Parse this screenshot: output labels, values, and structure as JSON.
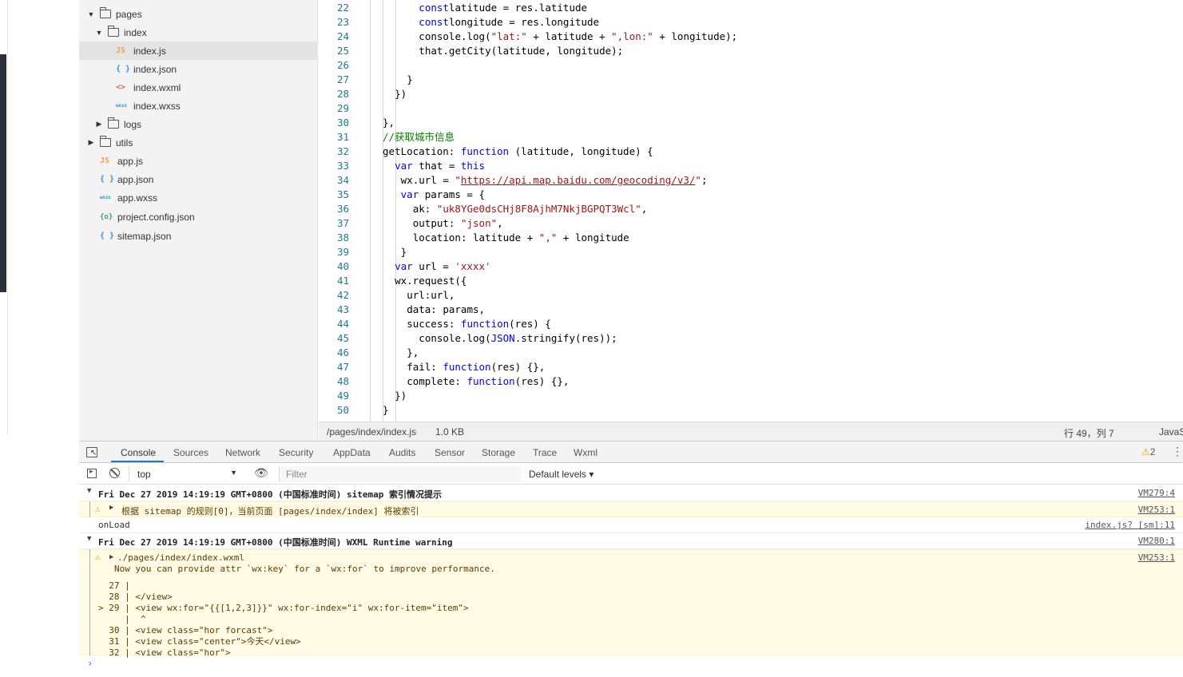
{
  "file_tree": [
    {
      "label": "pages",
      "type": "folder",
      "open": true,
      "depth": 0
    },
    {
      "label": "index",
      "type": "folder",
      "open": true,
      "depth": 1
    },
    {
      "label": "index.js",
      "type": "js",
      "depth": 2,
      "selected": true
    },
    {
      "label": "index.json",
      "type": "json",
      "depth": 2
    },
    {
      "label": "index.wxml",
      "type": "wxml",
      "depth": 2
    },
    {
      "label": "index.wxss",
      "type": "wxss",
      "depth": 2
    },
    {
      "label": "logs",
      "type": "folder",
      "open": false,
      "depth": 1
    },
    {
      "label": "utils",
      "type": "folder",
      "open": false,
      "depth": 0
    },
    {
      "label": "app.js",
      "type": "js",
      "depth": 0
    },
    {
      "label": "app.json",
      "type": "json",
      "depth": 0
    },
    {
      "label": "app.wxss",
      "type": "wxss",
      "depth": 0
    },
    {
      "label": "project.config.json",
      "type": "proj",
      "depth": 0
    },
    {
      "label": "sitemap.json",
      "type": "json",
      "depth": 0
    }
  ],
  "icon_glyphs": {
    "js": "JS",
    "json": "{ }",
    "wxml": "<>",
    "wxss": "wxss",
    "proj": "{o}"
  },
  "editor": {
    "lines": [
      {
        "n": "22",
        "indent": 3,
        "tokens": [
          [
            "kw",
            "const"
          ],
          [
            "",
            "latitude = res.latitude"
          ]
        ]
      },
      {
        "n": "23",
        "indent": 3,
        "tokens": [
          [
            "kw",
            "const"
          ],
          [
            "",
            "longitude = res.longitude"
          ]
        ]
      },
      {
        "n": "24",
        "indent": 3,
        "tokens": [
          [
            "",
            "console.log("
          ],
          [
            "str",
            "\"lat:\""
          ],
          [
            "",
            " + latitude + "
          ],
          [
            "str",
            "\",lon:\""
          ],
          [
            "",
            " + longitude);"
          ]
        ]
      },
      {
        "n": "25",
        "indent": 3,
        "tokens": [
          [
            "",
            "that.getCity(latitude, longitude);"
          ]
        ]
      },
      {
        "n": "26",
        "indent": 3,
        "tokens": []
      },
      {
        "n": "27",
        "indent": 2,
        "tokens": [
          [
            "",
            "}"
          ]
        ]
      },
      {
        "n": "28",
        "indent": 1,
        "tokens": [
          [
            "",
            "})"
          ]
        ]
      },
      {
        "n": "29",
        "indent": 0,
        "tokens": []
      },
      {
        "n": "30",
        "indent": 0,
        "tokens": [
          [
            "",
            "},"
          ]
        ]
      },
      {
        "n": "31",
        "indent": 0,
        "tokens": [
          [
            "cm",
            "//获取城市信息"
          ]
        ]
      },
      {
        "n": "32",
        "indent": 0,
        "tokens": [
          [
            "",
            "getLocation: "
          ],
          [
            "kw",
            "function"
          ],
          [
            "",
            " (latitude, longitude) {"
          ]
        ]
      },
      {
        "n": "33",
        "indent": 1,
        "tokens": [
          [
            "kw",
            "var"
          ],
          [
            "",
            " that = "
          ],
          [
            "kw",
            "this"
          ]
        ]
      },
      {
        "n": "34",
        "indent": 1.5,
        "tokens": [
          [
            "",
            "wx.url = "
          ],
          [
            "str",
            "\""
          ],
          [
            "url",
            "https://api.map.baidu.com/geocoding/v3/"
          ],
          [
            "str",
            "\""
          ],
          [
            "",
            ";"
          ]
        ]
      },
      {
        "n": "35",
        "indent": 1.5,
        "tokens": [
          [
            "kw",
            "var"
          ],
          [
            "",
            " params = {"
          ]
        ]
      },
      {
        "n": "36",
        "indent": 2.5,
        "tokens": [
          [
            "",
            "ak: "
          ],
          [
            "str",
            "\"uk8YGe0dsCHj8F8AjhM7NkjBGPQT3Wcl\""
          ],
          [
            "",
            ","
          ]
        ]
      },
      {
        "n": "37",
        "indent": 2.5,
        "tokens": [
          [
            "",
            "output: "
          ],
          [
            "str",
            "\"json\""
          ],
          [
            "",
            ","
          ]
        ]
      },
      {
        "n": "38",
        "indent": 2.5,
        "tokens": [
          [
            "",
            "location: latitude + "
          ],
          [
            "str",
            "\",\""
          ],
          [
            "",
            " + longitude"
          ]
        ]
      },
      {
        "n": "39",
        "indent": 1.5,
        "tokens": [
          [
            "",
            "}"
          ]
        ]
      },
      {
        "n": "40",
        "indent": 1,
        "tokens": [
          [
            "kw",
            "var"
          ],
          [
            "",
            " url = "
          ],
          [
            "str",
            "'xxxx'"
          ]
        ]
      },
      {
        "n": "41",
        "indent": 1,
        "tokens": [
          [
            "",
            "wx.request({"
          ]
        ]
      },
      {
        "n": "42",
        "indent": 2,
        "tokens": [
          [
            "",
            "url:url,"
          ]
        ]
      },
      {
        "n": "43",
        "indent": 2,
        "tokens": [
          [
            "",
            "data: params,"
          ]
        ]
      },
      {
        "n": "44",
        "indent": 2,
        "tokens": [
          [
            "",
            "success: "
          ],
          [
            "kw",
            "function"
          ],
          [
            "",
            "(res) {"
          ]
        ]
      },
      {
        "n": "45",
        "indent": 3,
        "tokens": [
          [
            "",
            "console.log("
          ],
          [
            "kw",
            "JSON"
          ],
          [
            "",
            ".stringify(res));"
          ]
        ]
      },
      {
        "n": "46",
        "indent": 2,
        "tokens": [
          [
            "",
            "},"
          ]
        ]
      },
      {
        "n": "47",
        "indent": 2,
        "tokens": [
          [
            "",
            "fail: "
          ],
          [
            "kw",
            "function"
          ],
          [
            "",
            "(res) {},"
          ]
        ]
      },
      {
        "n": "48",
        "indent": 2,
        "tokens": [
          [
            "",
            "complete: "
          ],
          [
            "kw",
            "function"
          ],
          [
            "",
            "(res) {},"
          ]
        ]
      },
      {
        "n": "49",
        "indent": 1,
        "tokens": [
          [
            "",
            "})"
          ]
        ]
      },
      {
        "n": "50",
        "indent": 0,
        "tokens": [
          [
            "",
            "}"
          ]
        ]
      }
    ]
  },
  "status_bar": {
    "path": "/pages/index/index.js",
    "size": "1.0 KB",
    "cursor": "行 49，列 7",
    "language": "JavaScript"
  },
  "devtools": {
    "tabs": [
      "Console",
      "Sources",
      "Network",
      "Security",
      "AppData",
      "Audits",
      "Sensor",
      "Storage",
      "Trace",
      "Wxml"
    ],
    "active_tab": "Console",
    "warning_count": "2",
    "context": "top",
    "filter_placeholder": "Filter",
    "levels": "Default levels"
  },
  "console": {
    "group1_header": "Fri Dec 27 2019 14:19:19 GMT+0800 (中国标准时间) sitemap 索引情况提示",
    "group1_src": "VM279:4",
    "warn1_text": "根据 sitemap 的规则[0]，当前页面 [pages/index/index] 将被索引",
    "warn1_src": "VM253:1",
    "log_text": "onLoad",
    "log_src": "index.js? [sm]:11",
    "group2_header": "Fri Dec 27 2019 14:19:19 GMT+0800 (中国标准时间) WXML Runtime warning",
    "group2_src": "VM280:1",
    "warn2_file": "./pages/index/index.wxml",
    "warn2_src": "VM253:1",
    "warn2_msg": "Now you can provide attr `wx:key` for a `wx:for` to improve performance.",
    "snippet": [
      "  27 |",
      "  28 | </view>",
      "> 29 | <view wx:for=\"{{[1,2,3]}}\" wx:for-index=\"i\" wx:for-item=\"item\">",
      "     |  ^",
      "  30 | <view class=\"hor forcast\">",
      "  31 | <view class=\"center\">今天</view>",
      "  32 | <view class=\"hor\">"
    ]
  }
}
